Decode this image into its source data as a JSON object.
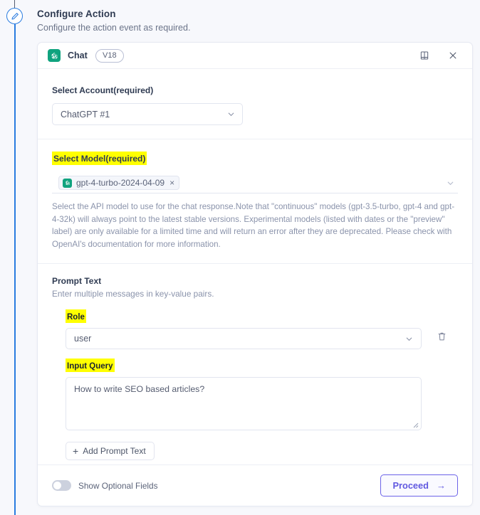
{
  "page": {
    "title": "Configure Action",
    "subtitle": "Configure the action event as required."
  },
  "rail": {
    "icon": "pencil-icon"
  },
  "card": {
    "header": {
      "app_icon": "openai-logo-icon",
      "app_name": "Chat",
      "version": "V18",
      "docs_icon": "book-icon",
      "close_icon": "close-icon"
    },
    "account": {
      "label": "Select Account",
      "required_text": "(required)",
      "value": "ChatGPT #1",
      "chevron_icon": "chevron-down-icon"
    },
    "model": {
      "label": "Select Model",
      "required_text": "(required)",
      "chip_label": "gpt-4-turbo-2024-04-09",
      "chip_remove": "×",
      "chip_icon": "openai-logo-icon",
      "chevron_icon": "chevron-down-icon",
      "help": "Select the API model to use for the chat response.Note that \"continuous\" models (gpt-3.5-turbo, gpt-4 and gpt-4-32k) will always point to the latest stable versions. Experimental models (listed with dates or the \"preview\" label) are only available for a limited time and will return an error after they are deprecated. Please check with OpenAI's documentation for more information."
    },
    "prompt": {
      "title": "Prompt Text",
      "subtitle": "Enter multiple messages in key-value pairs.",
      "role_label": "Role",
      "role_value": "user",
      "role_chevron_icon": "chevron-down-icon",
      "delete_icon": "trash-icon",
      "query_label": "Input Query",
      "query_value": "How to write SEO based articles?",
      "resize_icon": "resize-handle-icon",
      "add_button": "Add Prompt Text",
      "add_icon": "plus-icon"
    },
    "footer": {
      "toggle_label": "Show Optional Fields",
      "toggle_state": "off",
      "proceed_label": "Proceed",
      "proceed_arrow": "→"
    }
  },
  "colors": {
    "highlight": "#ffff00",
    "brand_green": "#10a37f",
    "accent_purple": "#6c63e8",
    "rail_blue": "#2a7ce0",
    "page_bg": "#f7f8fc"
  }
}
